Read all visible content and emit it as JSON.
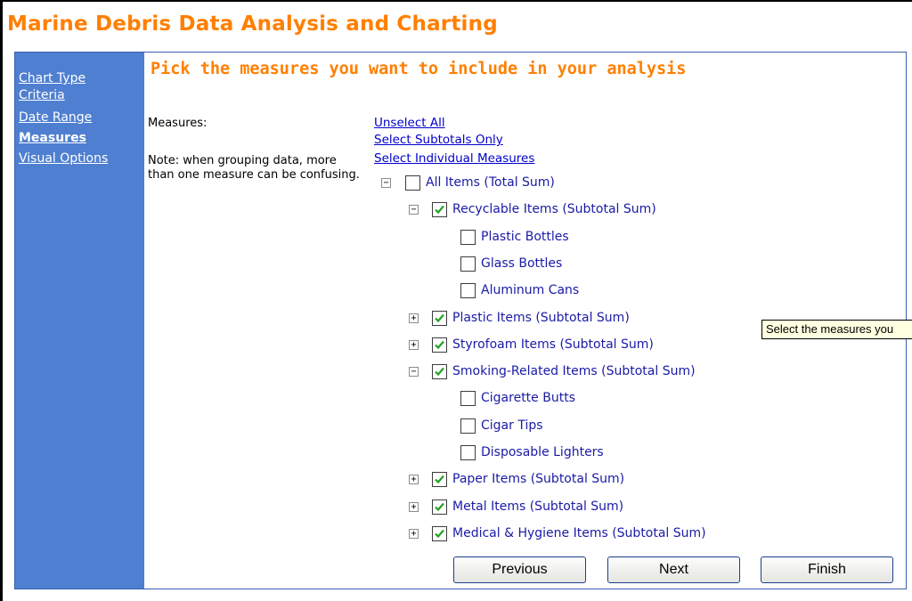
{
  "app": {
    "title": "Marine Debris Data Analysis and Charting"
  },
  "sidebar": {
    "items": [
      {
        "label": "Chart Type",
        "active": false
      },
      {
        "label": "Criteria",
        "active": false
      },
      {
        "label": "Date Range",
        "active": false
      },
      {
        "label": "Measures",
        "active": true
      },
      {
        "label": "Visual Options",
        "active": false
      }
    ]
  },
  "main": {
    "title": "Pick the measures you want to include in your analysis",
    "measures_label": "Measures:",
    "note": "Note: when grouping data, more than one measure can be confusing.",
    "links": {
      "unselect_all": "Unselect All",
      "select_subtotals": "Select Subtotals Only",
      "select_individual": "Select Individual Measures"
    },
    "tree": [
      {
        "label": "All Items (Total Sum)",
        "checked": false,
        "expander": "minus",
        "level": 0
      },
      {
        "label": "Recyclable Items (Subtotal Sum)",
        "checked": true,
        "expander": "minus",
        "level": 1
      },
      {
        "label": "Plastic Bottles",
        "checked": false,
        "expander": "none",
        "level": 2
      },
      {
        "label": "Glass Bottles",
        "checked": false,
        "expander": "none",
        "level": 2
      },
      {
        "label": "Aluminum Cans",
        "checked": false,
        "expander": "none",
        "level": 2
      },
      {
        "label": "Plastic Items (Subtotal Sum)",
        "checked": true,
        "expander": "plus",
        "level": 1
      },
      {
        "label": "Styrofoam Items (Subtotal Sum)",
        "checked": true,
        "expander": "plus",
        "level": 1
      },
      {
        "label": "Smoking-Related Items (Subtotal Sum)",
        "checked": true,
        "expander": "minus",
        "level": 1
      },
      {
        "label": "Cigarette Butts",
        "checked": false,
        "expander": "none",
        "level": 2
      },
      {
        "label": "Cigar Tips",
        "checked": false,
        "expander": "none",
        "level": 2
      },
      {
        "label": "Disposable Lighters",
        "checked": false,
        "expander": "none",
        "level": 2
      },
      {
        "label": "Paper Items (Subtotal Sum)",
        "checked": true,
        "expander": "plus",
        "level": 1
      },
      {
        "label": "Metal Items (Subtotal Sum)",
        "checked": true,
        "expander": "plus",
        "level": 1
      },
      {
        "label": "Medical & Hygiene Items (Subtotal Sum)",
        "checked": true,
        "expander": "plus",
        "level": 1
      }
    ]
  },
  "buttons": {
    "previous": "Previous",
    "next": "Next",
    "finish": "Finish"
  },
  "tooltip": {
    "text": "Select the measures you"
  },
  "colors": {
    "accent": "#ff7f00",
    "sidebar": "#4f7fd0",
    "link": "#0000cc",
    "tree_label": "#1a1aa6",
    "checkmark": "#21a121"
  }
}
